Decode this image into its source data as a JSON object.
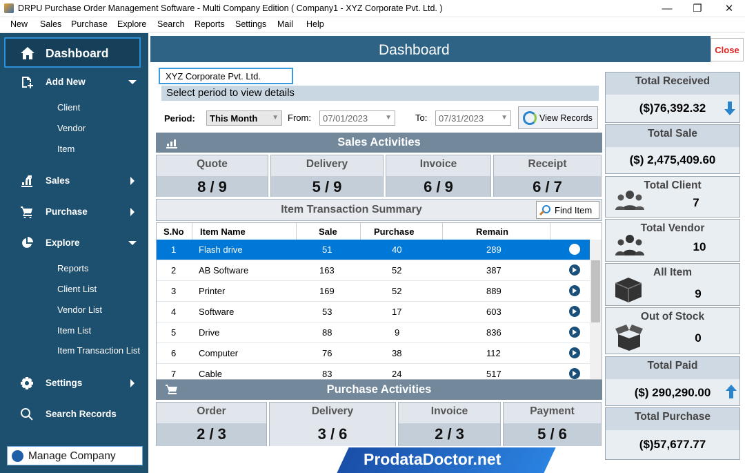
{
  "window": {
    "title": "DRPU Purchase Order Management Software - Multi Company Edition ( Company1 - XYZ Corporate Pvt. Ltd. )"
  },
  "menu": [
    "New",
    "Sales",
    "Purchase",
    "Explore",
    "Search",
    "Reports",
    "Settings",
    "Mail",
    "Help"
  ],
  "sidebar": {
    "dashboard": "Dashboard",
    "add_new": "Add New",
    "add_items": [
      "Client",
      "Vendor",
      "Item"
    ],
    "sales": "Sales",
    "purchase": "Purchase",
    "explore": "Explore",
    "explore_items": [
      "Reports",
      "Client List",
      "Vendor List",
      "Item List",
      "Item Transaction List"
    ],
    "settings": "Settings",
    "search_records": "Search Records",
    "manage_company": "Manage Company"
  },
  "header": {
    "title": "Dashboard",
    "close": "Close"
  },
  "company": "XYZ Corporate Pvt. Ltd.",
  "period": {
    "hint": "Select period to view details",
    "label": "Period:",
    "value": "This Month",
    "from_label": "From:",
    "from": "07/01/2023",
    "to_label": "To:",
    "to": "07/31/2023",
    "view_records": "View Records"
  },
  "sales_activities": {
    "title": "Sales Activities",
    "cards": [
      {
        "label": "Quote",
        "value": "8 / 9"
      },
      {
        "label": "Delivery",
        "value": "5 / 9"
      },
      {
        "label": "Invoice",
        "value": "6 / 9"
      },
      {
        "label": "Receipt",
        "value": "6 / 7"
      }
    ]
  },
  "item_summary": {
    "title": "Item Transaction Summary",
    "find": "Find Item",
    "columns": [
      "S.No",
      "Item Name",
      "Sale",
      "Purchase",
      "Remain"
    ],
    "rows": [
      {
        "no": "1",
        "name": "Flash drive",
        "sale": "51",
        "purchase": "40",
        "remain": "289"
      },
      {
        "no": "2",
        "name": "AB Software",
        "sale": "163",
        "purchase": "52",
        "remain": "387"
      },
      {
        "no": "3",
        "name": "Printer",
        "sale": "169",
        "purchase": "52",
        "remain": "889"
      },
      {
        "no": "4",
        "name": "Software",
        "sale": "53",
        "purchase": "17",
        "remain": "603"
      },
      {
        "no": "5",
        "name": "Drive",
        "sale": "88",
        "purchase": "9",
        "remain": "836"
      },
      {
        "no": "6",
        "name": "Computer",
        "sale": "76",
        "purchase": "38",
        "remain": "112"
      },
      {
        "no": "7",
        "name": "Cable",
        "sale": "83",
        "purchase": "24",
        "remain": "517"
      }
    ]
  },
  "purchase_activities": {
    "title": "Purchase Activities",
    "cards": [
      {
        "label": "Order",
        "value": "2 / 3"
      },
      {
        "label": "Delivery",
        "value": "3 / 6"
      },
      {
        "label": "Invoice",
        "value": "2 / 3"
      },
      {
        "label": "Payment",
        "value": "5 / 6"
      }
    ]
  },
  "summary": {
    "total_received": {
      "label": "Total Received",
      "value": "($)76,392.32"
    },
    "total_sale": {
      "label": "Total Sale",
      "value": "($) 2,475,409.60"
    },
    "total_client": {
      "label": "Total Client",
      "value": "7"
    },
    "total_vendor": {
      "label": "Total Vendor",
      "value": "10"
    },
    "all_item": {
      "label": "All Item",
      "value": "9"
    },
    "out_of_stock": {
      "label": "Out of Stock",
      "value": "0"
    },
    "total_paid": {
      "label": "Total Paid",
      "value": "($) 290,290.00"
    },
    "total_purchase": {
      "label": "Total Purchase",
      "value": "($)57,677.77"
    }
  },
  "brand": "ProdataDoctor.net",
  "colors": {
    "sidebar": "#1d4f6e",
    "accent": "#0078d7",
    "close": "#e32020"
  }
}
